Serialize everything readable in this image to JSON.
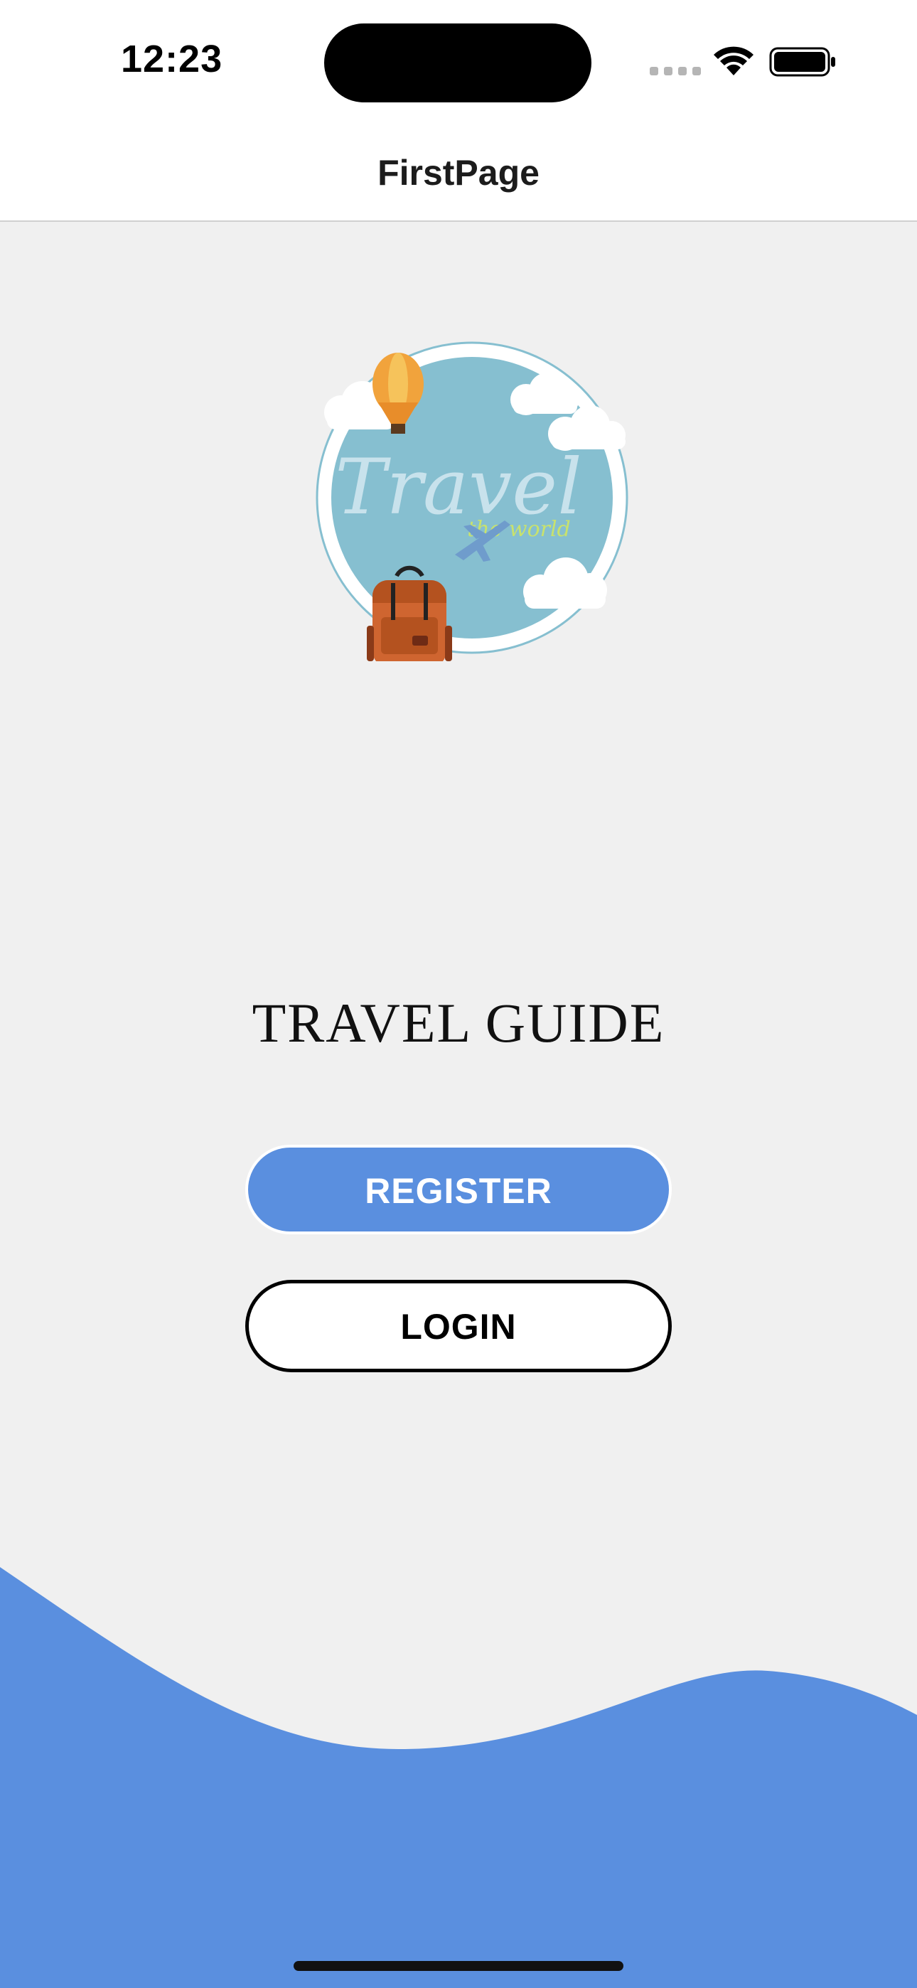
{
  "status_bar": {
    "time": "12:23",
    "icons": [
      "signal-dots-icon",
      "wifi-icon",
      "battery-icon"
    ]
  },
  "nav": {
    "title": "FirstPage"
  },
  "logo": {
    "text": "Travel",
    "subtext": "the world",
    "icons": [
      "hot-air-balloon-icon",
      "cloud-icon",
      "airplane-icon",
      "backpack-icon"
    ]
  },
  "app_title": "TRAVEL GUIDE",
  "buttons": {
    "register_label": "REGISTER",
    "login_label": "LOGIN"
  },
  "colors": {
    "accent": "#5a8fdf",
    "background": "#f0f0f0",
    "logo_circle": "#86bfd0"
  }
}
